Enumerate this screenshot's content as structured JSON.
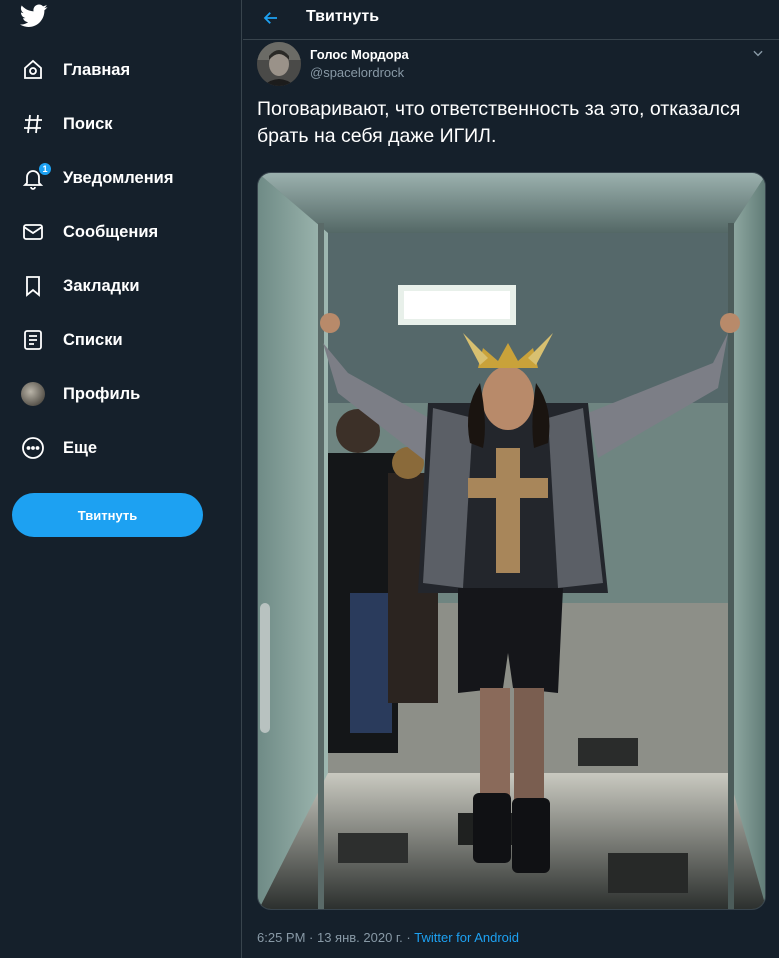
{
  "nav": {
    "items": [
      {
        "label": "Главная",
        "icon": "home-icon"
      },
      {
        "label": "Поиск",
        "icon": "hashtag-icon"
      },
      {
        "label": "Уведомления",
        "icon": "bell-icon",
        "badge": "1"
      },
      {
        "label": "Сообщения",
        "icon": "envelope-icon"
      },
      {
        "label": "Закладки",
        "icon": "bookmark-icon"
      },
      {
        "label": "Списки",
        "icon": "list-icon"
      },
      {
        "label": "Профиль",
        "icon": "avatar"
      },
      {
        "label": "Еще",
        "icon": "more-circle-icon"
      }
    ],
    "tweet_button": "Твитнуть"
  },
  "header": {
    "title": "Твитнуть"
  },
  "tweet": {
    "author_name": "Голос Мордора",
    "author_handle": "@spacelordrock",
    "text": "Поговаривают, что ответственность за это, отказался брать на себя даже ИГИЛ.",
    "time": "6:25 PM",
    "separator": " · ",
    "date": "13 янв. 2020 г.",
    "source": "Twitter for Android"
  },
  "colors": {
    "background": "#15202b",
    "accent": "#1da1f2",
    "muted": "#8899a6",
    "border": "#38444d"
  }
}
